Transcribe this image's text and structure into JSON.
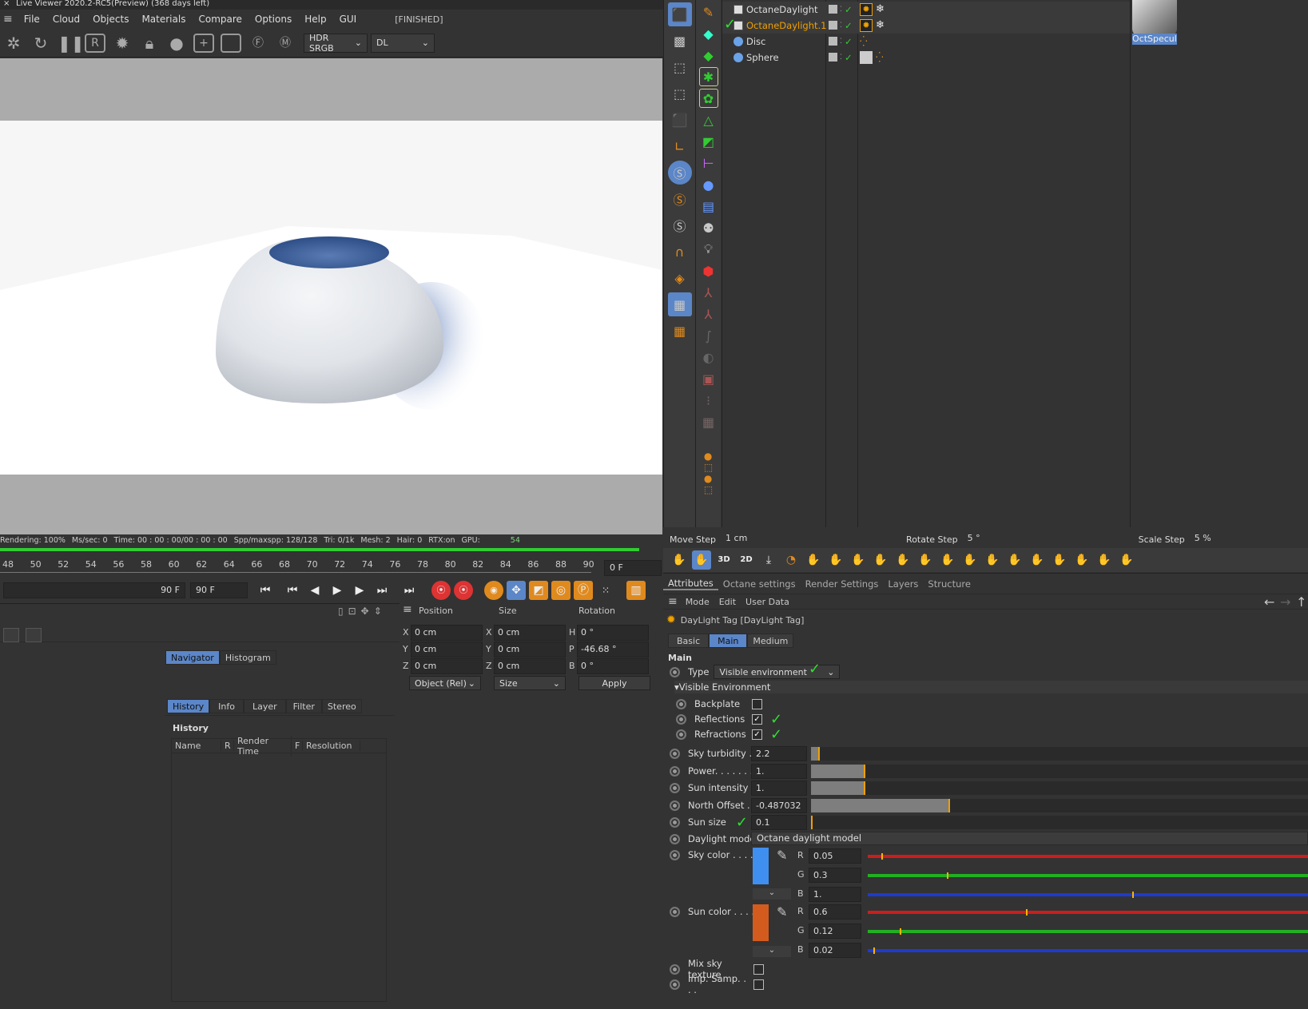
{
  "live_viewer": {
    "title": "Live Viewer 2020.2-RC5(Preview) (368 days left)",
    "menu": [
      "File",
      "Cloud",
      "Objects",
      "Materials",
      "Compare",
      "Options",
      "Help",
      "GUI"
    ],
    "status": "[FINISHED]",
    "color_space": "HDR SRGB",
    "kernel": "DL",
    "stats": {
      "rendering": "Rendering: 100%",
      "mssec": "Ms/sec: 0",
      "time": "Time: 00 : 00 : 00/00 : 00 : 00",
      "spp": "Spp/maxspp: 128/128",
      "tri": "Tri: 0/1k",
      "mesh": "Mesh: 2",
      "hair": "Hair: 0",
      "rtx": "RTX:on",
      "gpu": "GPU:",
      "gpu_val": "54"
    }
  },
  "timeline": {
    "ticks": [
      "48",
      "50",
      "52",
      "54",
      "56",
      "58",
      "60",
      "62",
      "64",
      "66",
      "68",
      "70",
      "72",
      "74",
      "76",
      "78",
      "80",
      "82",
      "84",
      "86",
      "88",
      "90"
    ],
    "current_frame": "0 F",
    "end_frame_a": "90 F",
    "end_frame_b": "90 F"
  },
  "coord": {
    "headers": [
      "Position",
      "Size",
      "Rotation"
    ],
    "rows": [
      {
        "axis": "X",
        "pos": "0 cm",
        "saxis": "X",
        "size": "0 cm",
        "raxis": "H",
        "rot": "0 °"
      },
      {
        "axis": "Y",
        "pos": "0 cm",
        "saxis": "Y",
        "size": "0 cm",
        "raxis": "P",
        "rot": "-46.68 °"
      },
      {
        "axis": "Z",
        "pos": "0 cm",
        "saxis": "Z",
        "size": "0 cm",
        "raxis": "B",
        "rot": "0 °"
      }
    ],
    "mode": "Object (Rel)",
    "size_mode": "Size",
    "apply": "Apply"
  },
  "lower_left": {
    "tabs1": [
      "Navigator",
      "Histogram"
    ],
    "tabs2": [
      "History",
      "Info",
      "Layer",
      "Filter",
      "Stereo"
    ],
    "history_title": "History",
    "columns": [
      "Name",
      "R",
      "Render Time",
      "F",
      "Resolution"
    ]
  },
  "objects": [
    {
      "name": "OctaneDaylight",
      "active": false
    },
    {
      "name": "OctaneDaylight.1",
      "active": true
    },
    {
      "name": "Disc",
      "active": false
    },
    {
      "name": "Sphere",
      "active": false
    }
  ],
  "material": {
    "name": "OctSpecula"
  },
  "steps": {
    "move_label": "Move Step",
    "move": "1 cm",
    "rotate_label": "Rotate Step",
    "rotate": "5 °",
    "scale_label": "Scale Step",
    "scale": "5 %"
  },
  "attr": {
    "tabs": [
      "Attributes",
      "Octane settings",
      "Render Settings",
      "Layers",
      "Structure"
    ],
    "menu": [
      "Mode",
      "Edit",
      "User Data"
    ],
    "title": "DayLight Tag [DayLight Tag]",
    "subtabs": [
      "Basic",
      "Main",
      "Medium"
    ],
    "section": "Main",
    "type_label": "Type",
    "type_value": "Visible environment",
    "group": "Visible Environment",
    "backplate": "Backplate",
    "reflections": "Reflections",
    "refractions": "Refractions",
    "sky_turbidity": {
      "label": "Sky turbidity . .",
      "value": "2.2",
      "fill": 0.017
    },
    "power": {
      "label": "Power. . . . . . .",
      "value": "1.",
      "fill": 0.11
    },
    "sun_intensity": {
      "label": "Sun intensity . .",
      "value": "1.",
      "fill": 0.11
    },
    "north_offset": {
      "label": "North Offset . . .",
      "value": "-0.487032",
      "fill": 0.28
    },
    "sun_size": {
      "label": "Sun size",
      "value": "0.1",
      "fill": 0.002
    },
    "daylight_model_label": "Daylight model",
    "daylight_model": "Octane daylight model",
    "sky_color": {
      "label": "Sky color . . . .",
      "swatch": "#3f8ff0",
      "r": "0.05",
      "g": "0.3",
      "b": "1.",
      "rf": 0.05,
      "gf": 0.3,
      "bf": 1.0
    },
    "sun_color": {
      "label": "Sun color . . . .",
      "swatch": "#d45b1e",
      "r": "0.6",
      "g": "0.12",
      "b": "0.02",
      "rf": 0.6,
      "gf": 0.12,
      "bf": 0.02
    },
    "mix_sky": "Mix sky texture",
    "imp_samp": "Imp. Samp. . . .",
    "channel_r": "R",
    "channel_g": "G",
    "channel_b": "B"
  },
  "colors": {
    "accent": "#5b86c8",
    "slider_marker": "#f0a000",
    "progress": "#33cc33"
  }
}
